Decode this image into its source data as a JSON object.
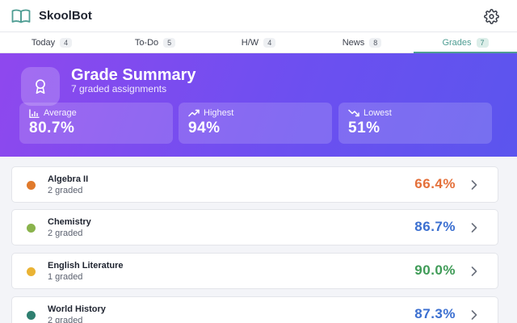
{
  "app": {
    "title": "SkoolBot",
    "logo_icon": "open-book-icon",
    "settings_icon": "gear-icon"
  },
  "tabs": [
    {
      "label": "Today",
      "count": "4"
    },
    {
      "label": "To-Do",
      "count": "5"
    },
    {
      "label": "H/W",
      "count": "4"
    },
    {
      "label": "News",
      "count": "8"
    },
    {
      "label": "Grades",
      "count": "7",
      "active": true
    }
  ],
  "summary": {
    "title": "Grade Summary",
    "subtitle": "7 graded assignments",
    "icon": "medal-icon",
    "stats": {
      "average": {
        "label": "Average",
        "value": "80.7%",
        "icon": "bar-chart-icon"
      },
      "highest": {
        "label": "Highest",
        "value": "94%",
        "icon": "trending-up-icon"
      },
      "lowest": {
        "label": "Lowest",
        "value": "51%",
        "icon": "trending-down-icon"
      }
    }
  },
  "courses": [
    {
      "name": "Algebra II",
      "graded": "2 graded",
      "percent": "66.4%",
      "dot_color": "#e07a2c",
      "percent_color": "#e4703a"
    },
    {
      "name": "Chemistry",
      "graded": "2 graded",
      "percent": "86.7%",
      "dot_color": "#8ab34c",
      "percent_color": "#3b6fd0"
    },
    {
      "name": "English Literature",
      "graded": "1 graded",
      "percent": "90.0%",
      "dot_color": "#eab334",
      "percent_color": "#3f9b57"
    },
    {
      "name": "World History",
      "graded": "2 graded",
      "percent": "87.3%",
      "dot_color": "#2f7f70",
      "percent_color": "#3b6fd0"
    }
  ],
  "colors": {
    "accent": "#4e9d93",
    "hero_start": "#8f48ee",
    "hero_end": "#5b55ee"
  }
}
